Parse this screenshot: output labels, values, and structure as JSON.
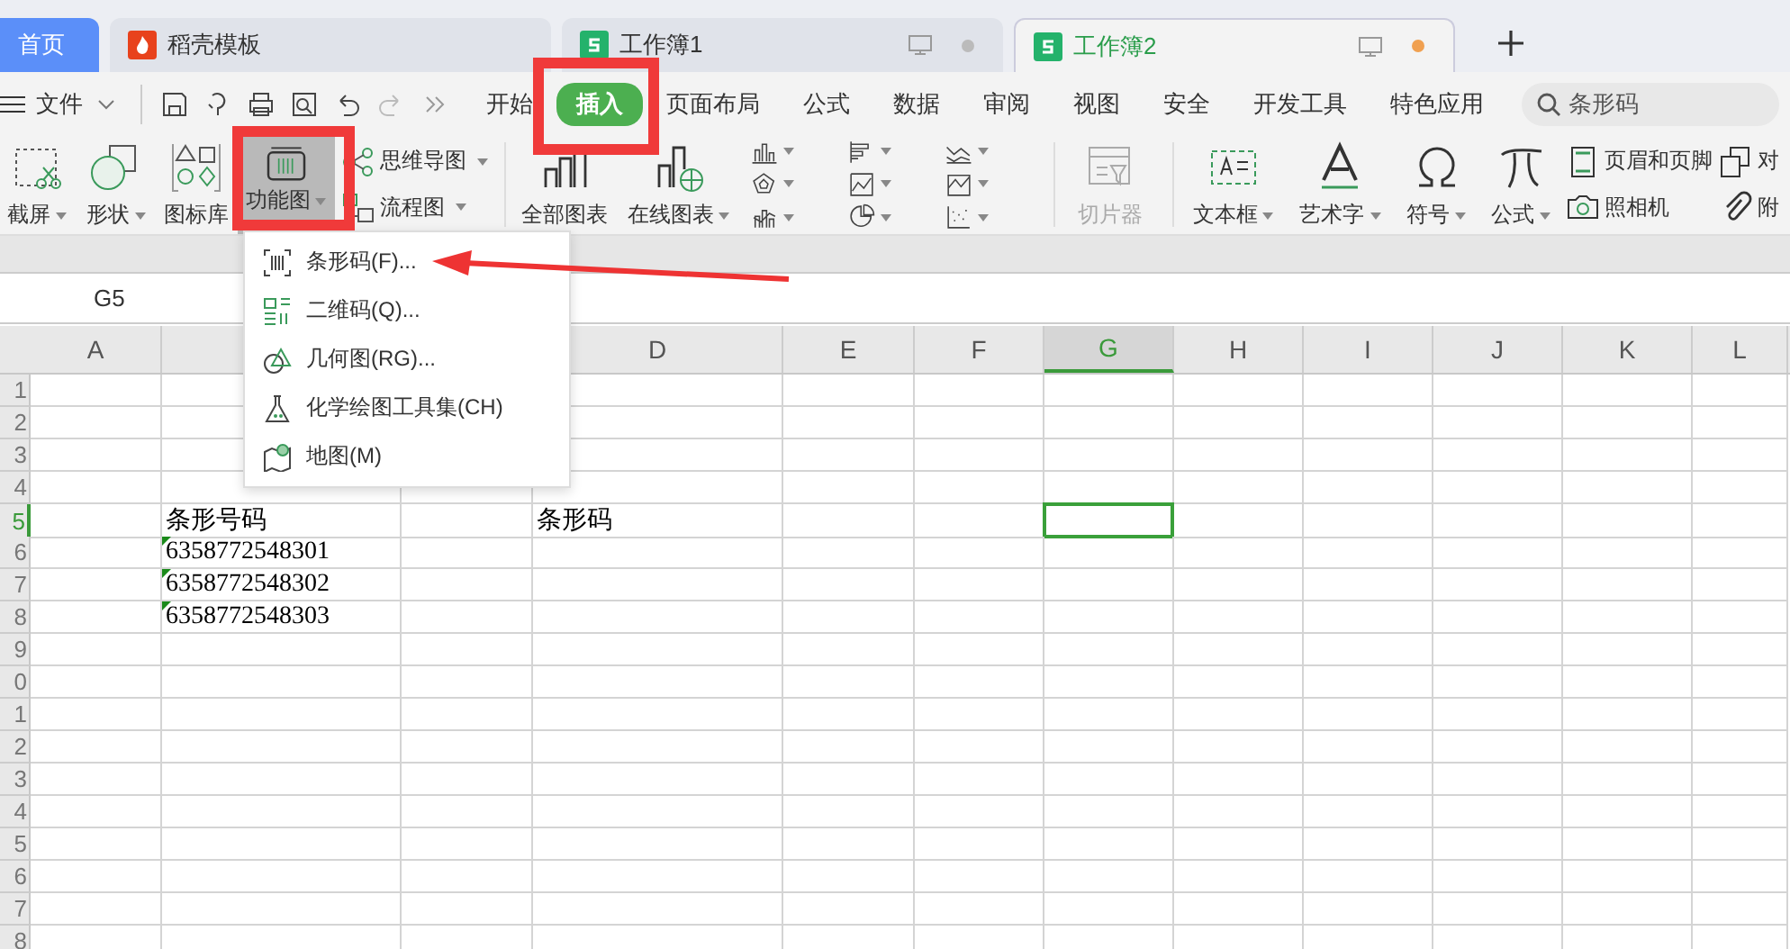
{
  "tabs": [
    {
      "kind": "home",
      "label": "首页",
      "selected": false
    },
    {
      "kind": "template",
      "label": "稻壳模板",
      "selected": false
    },
    {
      "kind": "workbook",
      "label": "工作簿1",
      "selected": false,
      "modified": false
    },
    {
      "kind": "workbook",
      "label": "工作簿2",
      "selected": true,
      "modified": true
    }
  ],
  "file_menu": {
    "label": "文件"
  },
  "menu_tabs": [
    {
      "label": "开始",
      "selected": false
    },
    {
      "label": "插入",
      "selected": true
    },
    {
      "label": "页面布局",
      "selected": false
    },
    {
      "label": "公式",
      "selected": false
    },
    {
      "label": "数据",
      "selected": false
    },
    {
      "label": "审阅",
      "selected": false
    },
    {
      "label": "视图",
      "selected": false
    },
    {
      "label": "安全",
      "selected": false
    },
    {
      "label": "开发工具",
      "selected": false
    },
    {
      "label": "特色应用",
      "selected": false
    }
  ],
  "search": {
    "value": "条形码"
  },
  "ribbon": {
    "screenshot": {
      "label": "截屏"
    },
    "shapes": {
      "label": "形状"
    },
    "icon_library": {
      "label": "图标库"
    },
    "function_chart": {
      "label": "功能图",
      "pressed": true
    },
    "mind_map": {
      "label": "思维导图"
    },
    "flowchart": {
      "label": "流程图"
    },
    "all_charts": {
      "label": "全部图表"
    },
    "online_charts": {
      "label": "在线图表"
    },
    "slicer": {
      "label": "切片器",
      "disabled": true
    },
    "text_box": {
      "label": "文本框"
    },
    "word_art": {
      "label": "艺术字"
    },
    "symbol": {
      "label": "符号"
    },
    "formula": {
      "label": "公式"
    },
    "header_footer": {
      "label": "页眉和页脚"
    },
    "camera": {
      "label": "照相机"
    },
    "object": {
      "label": "对"
    },
    "attachment": {
      "label": "附"
    }
  },
  "dropdown": {
    "items": [
      {
        "label": "条形码(F)..."
      },
      {
        "label": "二维码(Q)..."
      },
      {
        "label": "几何图(RG)..."
      },
      {
        "label": "化学绘图工具集(CH)"
      },
      {
        "label": "地图(M)"
      }
    ]
  },
  "formula_bar": {
    "cell_ref": "G5"
  },
  "columns": [
    {
      "label": "A",
      "selected": false
    },
    {
      "label": "D",
      "selected": false
    },
    {
      "label": "E",
      "selected": false
    },
    {
      "label": "F",
      "selected": false
    },
    {
      "label": "G",
      "selected": true
    },
    {
      "label": "H",
      "selected": false
    },
    {
      "label": "I",
      "selected": false
    },
    {
      "label": "J",
      "selected": false
    },
    {
      "label": "K",
      "selected": false
    },
    {
      "label": "L",
      "selected": false
    }
  ],
  "rows": [
    {
      "number": "1",
      "selected": false
    },
    {
      "number": "2",
      "selected": false
    },
    {
      "number": "3",
      "selected": false
    },
    {
      "number": "4",
      "selected": false
    },
    {
      "number": "5",
      "selected": true,
      "cell_b": "条形号码",
      "cell_d": "条形码"
    },
    {
      "number": "6",
      "selected": false,
      "cell_b": "6358772548301",
      "flagged": true
    },
    {
      "number": "7",
      "selected": false,
      "cell_b": "6358772548302",
      "flagged": true
    },
    {
      "number": "8",
      "selected": false,
      "cell_b": "6358772548303",
      "flagged": true
    },
    {
      "number": "9",
      "selected": false
    },
    {
      "number": "0",
      "selected": false
    },
    {
      "number": "1",
      "selected": false
    },
    {
      "number": "2",
      "selected": false
    },
    {
      "number": "3",
      "selected": false
    },
    {
      "number": "4",
      "selected": false
    },
    {
      "number": "5",
      "selected": false
    },
    {
      "number": "6",
      "selected": false
    },
    {
      "number": "7",
      "selected": false
    },
    {
      "number": "8",
      "selected": false
    }
  ]
}
